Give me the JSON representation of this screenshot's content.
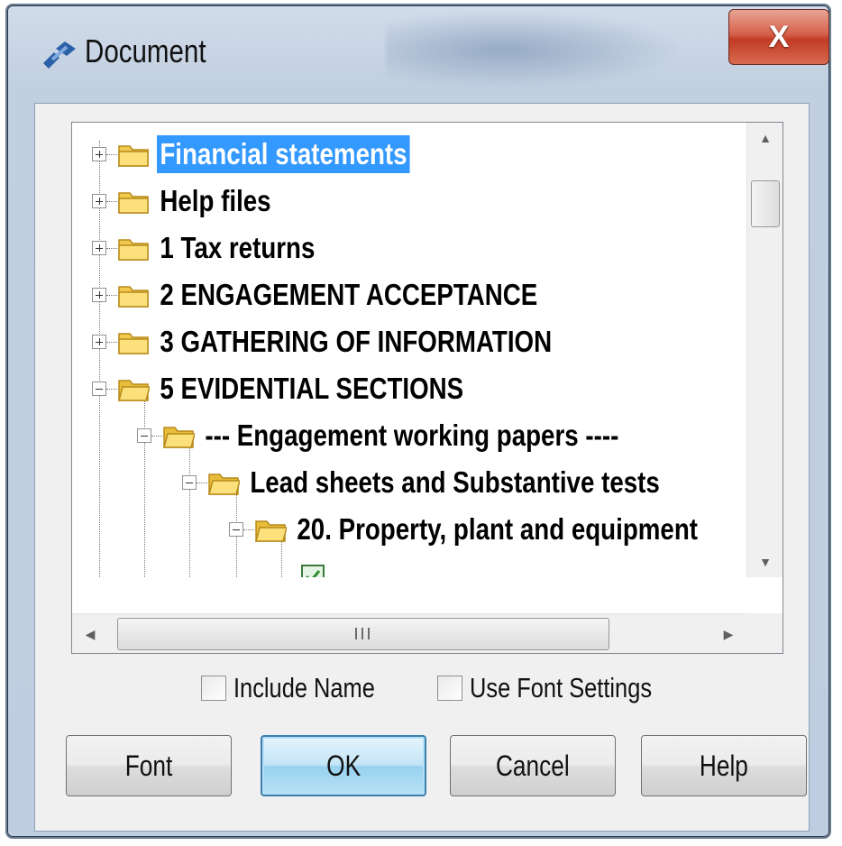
{
  "window": {
    "title": "Document",
    "close_label": "X",
    "icon": "document-link-icon"
  },
  "tree": {
    "items": [
      {
        "label": "Financial statements",
        "expander": "plus",
        "selected": true
      },
      {
        "label": "Help files",
        "expander": "plus"
      },
      {
        "label": "1 Tax returns",
        "expander": "plus"
      },
      {
        "label": "2 ENGAGEMENT ACCEPTANCE",
        "expander": "plus"
      },
      {
        "label": "3 GATHERING OF INFORMATION",
        "expander": "plus"
      },
      {
        "label": "5 EVIDENTIAL SECTIONS",
        "expander": "minus"
      },
      {
        "label": "--- Engagement working papers ----",
        "expander": "minus"
      },
      {
        "label": "Lead sheets and Substantive tests",
        "expander": "minus"
      },
      {
        "label": "20.  Property, plant and equipment",
        "expander": "minus"
      }
    ]
  },
  "hscroll": {
    "grip": "III"
  },
  "options": {
    "include_name": {
      "label": "Include Name",
      "checked": false
    },
    "use_font_settings": {
      "label": "Use Font Settings",
      "checked": false
    }
  },
  "buttons": {
    "font": "Font",
    "ok": "OK",
    "cancel": "Cancel",
    "help": "Help"
  },
  "colors": {
    "selection": "#3399ff",
    "close_button": "#c9452d",
    "default_button": "#98d1ef"
  }
}
